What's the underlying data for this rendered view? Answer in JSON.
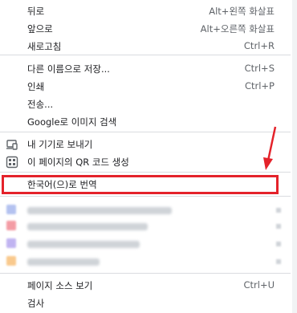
{
  "menu": {
    "back": {
      "label": "뒤로",
      "shortcut": "Alt+왼쪽 화살표"
    },
    "forward": {
      "label": "앞으로",
      "shortcut": "Alt+오른쪽 화살표"
    },
    "reload": {
      "label": "새로고침",
      "shortcut": "Ctrl+R"
    },
    "save_as": {
      "label": "다른 이름으로 저장...",
      "shortcut": "Ctrl+S"
    },
    "print": {
      "label": "인쇄",
      "shortcut": "Ctrl+P"
    },
    "cast": {
      "label": "전송..."
    },
    "search_image": {
      "label": "Google로 이미지 검색"
    },
    "send_to_devices": {
      "label": "내 기기로 보내기",
      "icon": "device-icon"
    },
    "qr_code": {
      "label": "이 페이지의 QR 코드 생성",
      "icon": "qr-code-icon"
    },
    "translate": {
      "label": "한국어(으)로 번역"
    },
    "view_source": {
      "label": "페이지 소스 보기",
      "shortcut": "Ctrl+U"
    },
    "inspect": {
      "label": "검사"
    }
  },
  "extensions": {
    "items": [
      {
        "icon": "extension-icon",
        "color": "#a7b8ee"
      },
      {
        "icon": "extension-icon",
        "color": "#f28b95"
      },
      {
        "icon": "extension-icon",
        "color": "#b6a7ef"
      },
      {
        "icon": "extension-icon",
        "color": "#f8c07a"
      }
    ]
  },
  "annotation": {
    "highlight_color": "#e4222a"
  }
}
